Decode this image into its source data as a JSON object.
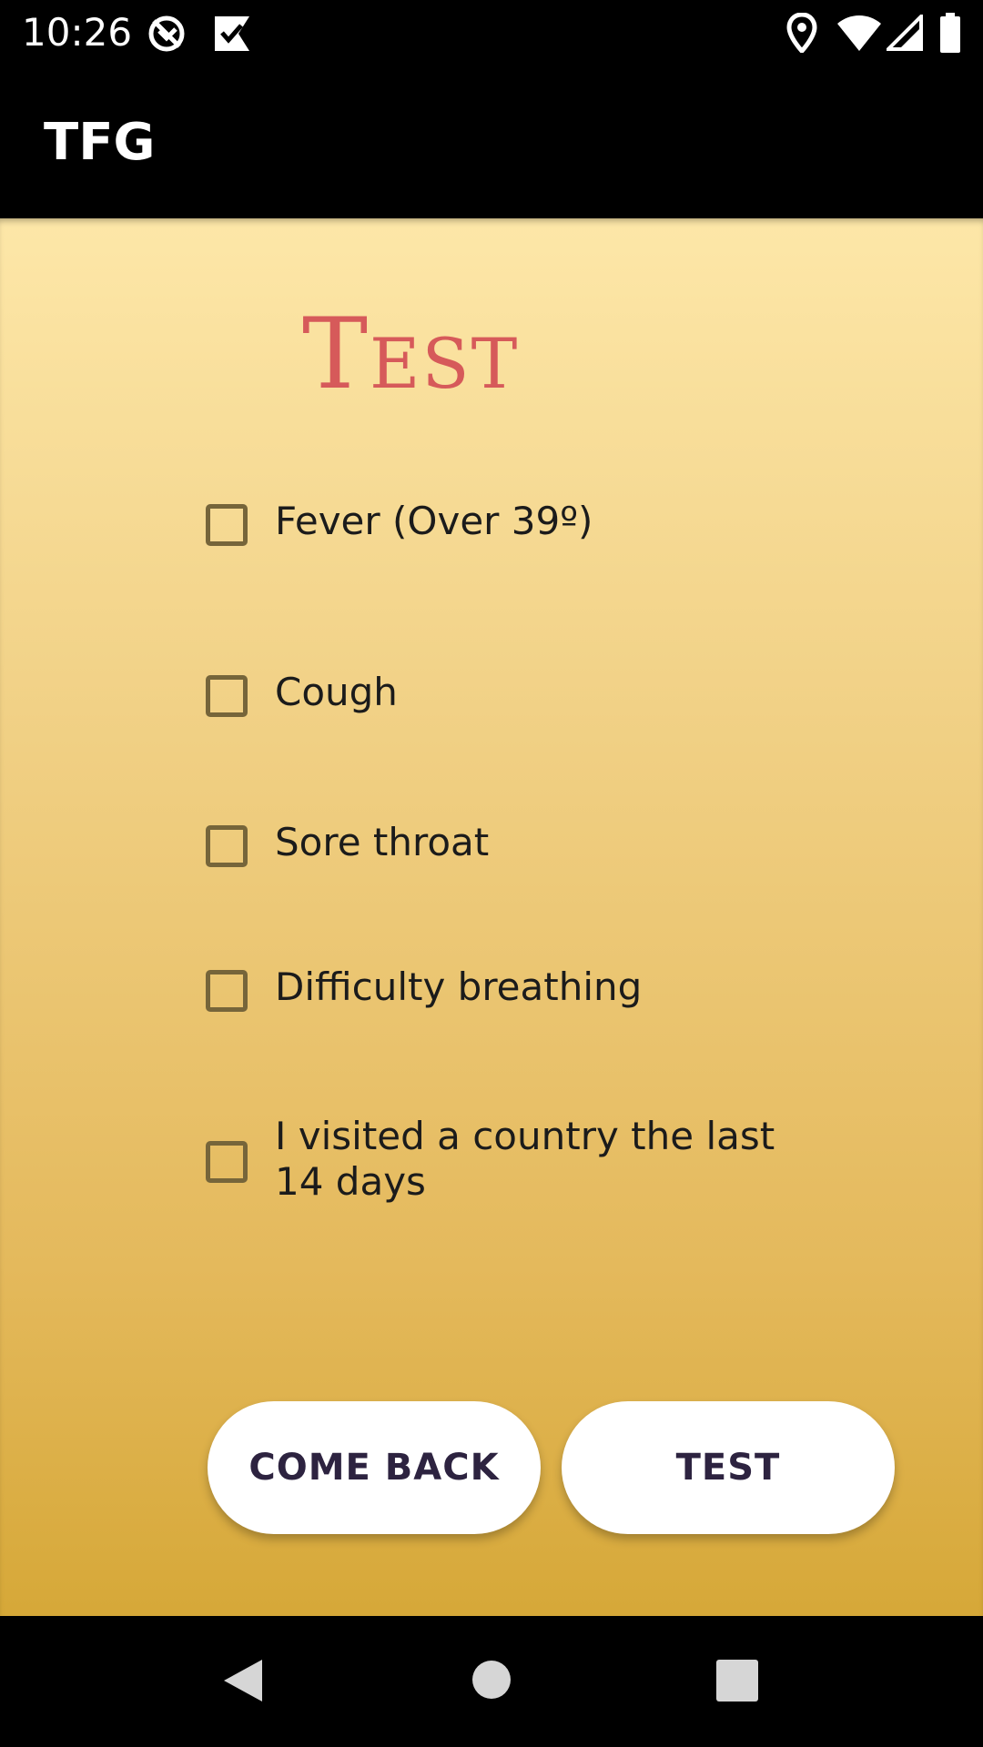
{
  "status_bar": {
    "time": "10:26",
    "left_icons": [
      "sync-off-icon",
      "checkmark-flag-icon"
    ],
    "right_icons": [
      "location-icon",
      "wifi-icon",
      "signal-icon",
      "battery-icon"
    ]
  },
  "app_bar": {
    "title": "TFG"
  },
  "page": {
    "title": "Test",
    "title_color": "#d65a5a",
    "background_top": "#fde7a8",
    "background_bottom": "#d6a838"
  },
  "symptoms": [
    {
      "label": "Fever (Over 39º)",
      "checked": false
    },
    {
      "label": "Cough",
      "checked": false
    },
    {
      "label": "Sore throat",
      "checked": false
    },
    {
      "label": "Difficulty breathing",
      "checked": false
    },
    {
      "label": " I visited a country the last 14 days",
      "checked": false
    }
  ],
  "buttons": {
    "come_back": "COME BACK",
    "test": "TEST"
  },
  "nav_bar": {
    "icons": [
      "back-icon",
      "home-icon",
      "recents-icon"
    ]
  }
}
